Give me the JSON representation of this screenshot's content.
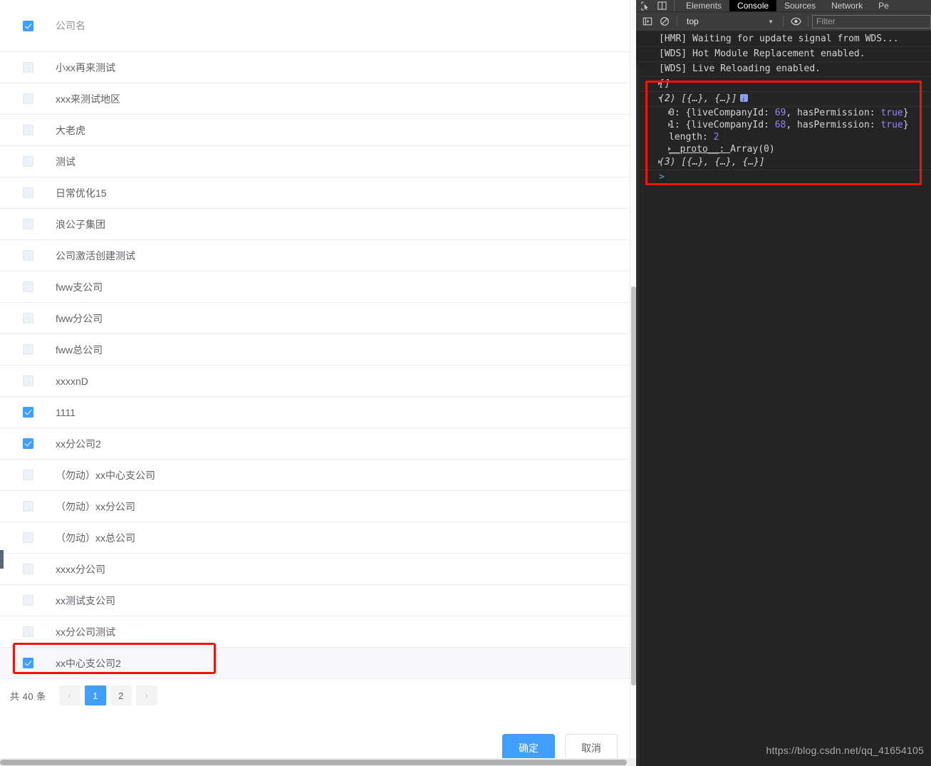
{
  "dialog": {
    "column_header": "公司名",
    "header_checkbox_checked": true,
    "rows": [
      {
        "name": "小xx再来测试",
        "checked": false,
        "redacted": true
      },
      {
        "name": "xxx来测试地区",
        "checked": false,
        "redacted": true
      },
      {
        "name": "大老虎",
        "checked": false,
        "redacted": false
      },
      {
        "name": "测试",
        "checked": false,
        "redacted": false
      },
      {
        "name": "日常优化15",
        "checked": false,
        "redacted": false
      },
      {
        "name": "浪公子集团",
        "checked": false,
        "redacted": false
      },
      {
        "name": "公司激活创建测试",
        "checked": false,
        "redacted": false
      },
      {
        "name": "fww支公司",
        "checked": false,
        "redacted": false
      },
      {
        "name": "fww分公司",
        "checked": false,
        "redacted": false
      },
      {
        "name": "fww总公司",
        "checked": false,
        "redacted": false
      },
      {
        "name": "xxxxnD",
        "checked": false,
        "redacted": true
      },
      {
        "name": "1111",
        "checked": true,
        "redacted": true
      },
      {
        "name": "xx分公司2",
        "checked": true,
        "redacted": true
      },
      {
        "name": "（勿动）xx中心支公司",
        "checked": false,
        "redacted": true
      },
      {
        "name": "（勿动）xx分公司",
        "checked": false,
        "redacted": true
      },
      {
        "name": "（勿动）xx总公司",
        "checked": false,
        "redacted": true
      },
      {
        "name": "xxxx分公司",
        "checked": false,
        "redacted": true
      },
      {
        "name": "xx测试支公司",
        "checked": false,
        "redacted": true
      },
      {
        "name": "xx分公司测试",
        "checked": false,
        "redacted": true
      },
      {
        "name": "xx中心支公司2",
        "checked": true,
        "redacted": true,
        "highlighted": true,
        "annotated": true
      }
    ],
    "pagination": {
      "total_label": "共 40 条",
      "prev_label": "‹",
      "next_label": "›",
      "pages": [
        "1",
        "2"
      ],
      "active_page": "1"
    },
    "footer": {
      "confirm_label": "确定",
      "cancel_label": "取消"
    }
  },
  "devtools": {
    "tabs": [
      {
        "label": "Elements",
        "active": false
      },
      {
        "label": "Console",
        "active": true
      },
      {
        "label": "Sources",
        "active": false
      },
      {
        "label": "Network",
        "active": false
      },
      {
        "label": "Pe",
        "active": false
      }
    ],
    "toolbar": {
      "context_value": "top",
      "filter_placeholder": "Filter",
      "filter_value": ""
    },
    "console_lines": [
      {
        "kind": "text",
        "text": "[HMR] Waiting for update signal from WDS..."
      },
      {
        "kind": "text",
        "text": "[WDS] Hot Module Replacement enabled."
      },
      {
        "kind": "text",
        "text": "[WDS] Live Reloading enabled."
      },
      {
        "kind": "object",
        "expanded": false,
        "text": "[]"
      },
      {
        "kind": "object",
        "expanded": true,
        "text": "(2) [{…}, {…}]",
        "badge": true
      }
    ],
    "expanded_props": [
      {
        "prefix": "0: ",
        "body": "{liveCompanyId: ",
        "value": "69",
        "tail": ", hasPermission: ",
        "bool": "true",
        "close": "}",
        "arrow": true
      },
      {
        "prefix": "1: ",
        "body": "{liveCompanyId: ",
        "value": "68",
        "tail": ", hasPermission: ",
        "bool": "true",
        "close": "}",
        "arrow": true
      },
      {
        "prefix": "length: ",
        "value": "2",
        "arrow": false
      },
      {
        "prefix": "__proto__: ",
        "plain": "Array(0)",
        "arrow": true
      }
    ],
    "trailing_line": {
      "kind": "object",
      "expanded": false,
      "text": "(3) [{…}, {…}, {…}]"
    },
    "prompt": ">"
  },
  "watermark": "https://blog.csdn.net/qq_41654105",
  "colors": {
    "accent": "#409eff",
    "annotation_red": "#f2140c",
    "devtools_bg": "#242424",
    "row_highlight": "#f5f7fa"
  }
}
